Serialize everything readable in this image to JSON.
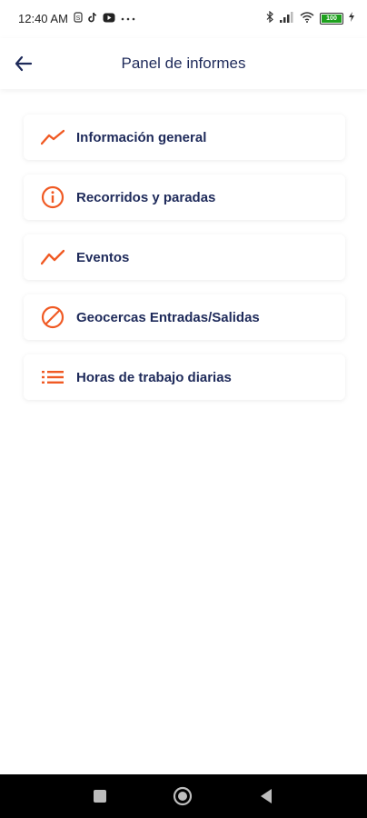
{
  "status_bar": {
    "time": "12:40 AM",
    "left_icons": [
      "sim-icon",
      "tiktok-icon",
      "youtube-icon",
      "more-icon"
    ],
    "right_icons": [
      "bluetooth-icon",
      "signal-icon",
      "wifi-icon",
      "battery-icon"
    ],
    "battery_level": "100"
  },
  "header": {
    "title": "Panel de informes",
    "back_icon": "arrow-left-icon"
  },
  "menu": {
    "items": [
      {
        "label": "Información general",
        "icon": "trend-line-icon"
      },
      {
        "label": "Recorridos y paradas",
        "icon": "info-circle-icon"
      },
      {
        "label": "Eventos",
        "icon": "trend-line-icon"
      },
      {
        "label": "Geocercas Entradas/Salidas",
        "icon": "no-entry-icon"
      },
      {
        "label": "Horas de trabajo diarias",
        "icon": "list-icon"
      }
    ]
  },
  "nav_bar": {
    "buttons": [
      "recent-apps-icon",
      "home-icon",
      "back-triangle-icon"
    ]
  },
  "colors": {
    "accent": "#f05a24",
    "title": "#1e2a5a"
  }
}
